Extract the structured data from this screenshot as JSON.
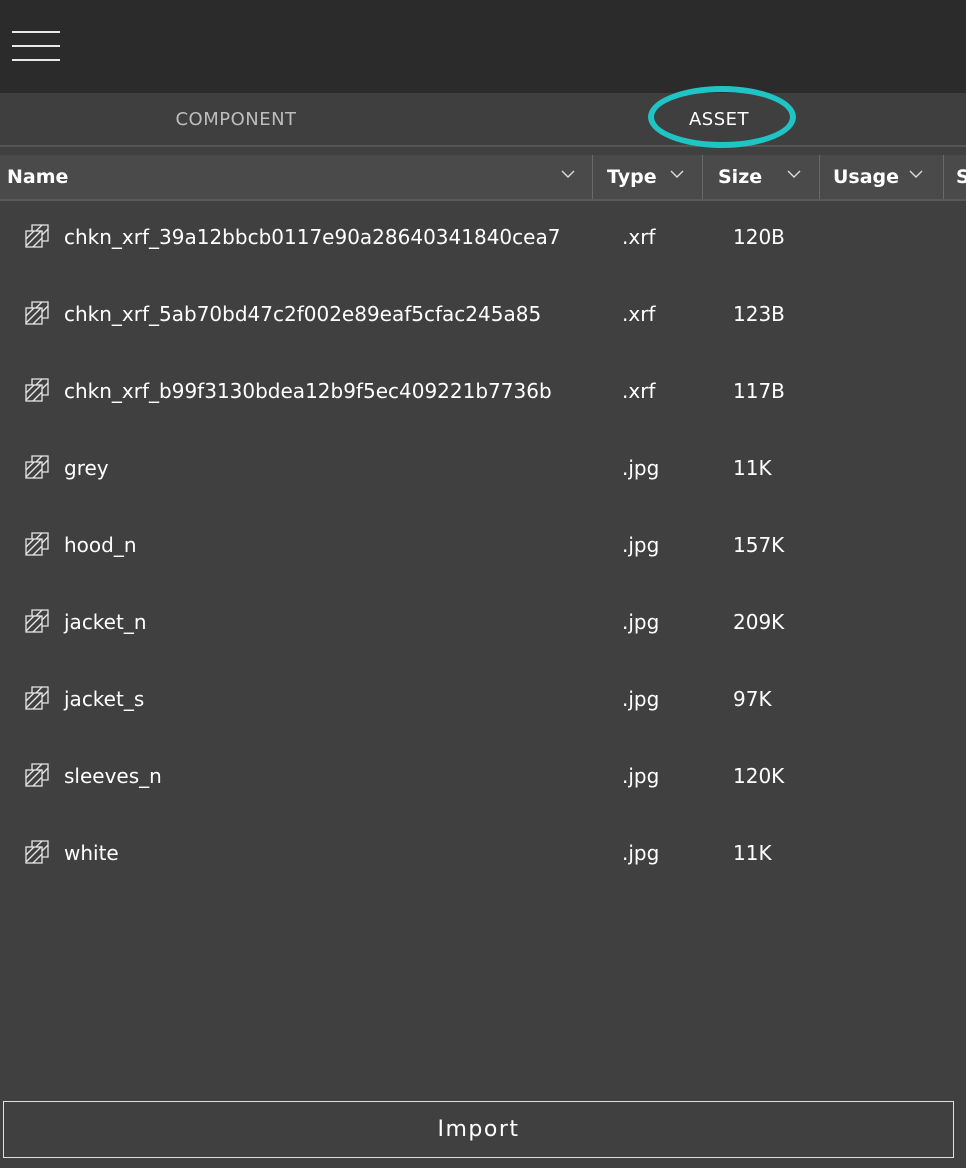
{
  "tabs": {
    "component": "COMPONENT",
    "asset": "ASSET",
    "selected": "ASSET",
    "highlight_color": "#1fc4c4"
  },
  "columns": {
    "name": "Name",
    "type": "Type",
    "size": "Size",
    "usage": "Usage",
    "extra": "S"
  },
  "assets": [
    {
      "name": "chkn_xrf_39a12bbcb0117e90a28640341840cea7",
      "type": ".xrf",
      "size": "120B",
      "icon": "texture-icon"
    },
    {
      "name": "chkn_xrf_5ab70bd47c2f002e89eaf5cfac245a85",
      "type": ".xrf",
      "size": "123B",
      "icon": "texture-icon"
    },
    {
      "name": "chkn_xrf_b99f3130bdea12b9f5ec409221b7736b",
      "type": ".xrf",
      "size": "117B",
      "icon": "texture-icon"
    },
    {
      "name": "grey",
      "type": ".jpg",
      "size": "11K",
      "icon": "texture-icon"
    },
    {
      "name": "hood_n",
      "type": ".jpg",
      "size": "157K",
      "icon": "texture-icon"
    },
    {
      "name": "jacket_n",
      "type": ".jpg",
      "size": "209K",
      "icon": "texture-icon"
    },
    {
      "name": "jacket_s",
      "type": ".jpg",
      "size": "97K",
      "icon": "texture-icon"
    },
    {
      "name": "sleeves_n",
      "type": ".jpg",
      "size": "120K",
      "icon": "texture-icon"
    },
    {
      "name": "white",
      "type": ".jpg",
      "size": "11K",
      "icon": "texture-icon"
    }
  ],
  "import_label": "Import",
  "colors": {
    "topbar": "#2b2b2b",
    "panel": "#404040",
    "header": "#4a4a4a"
  }
}
